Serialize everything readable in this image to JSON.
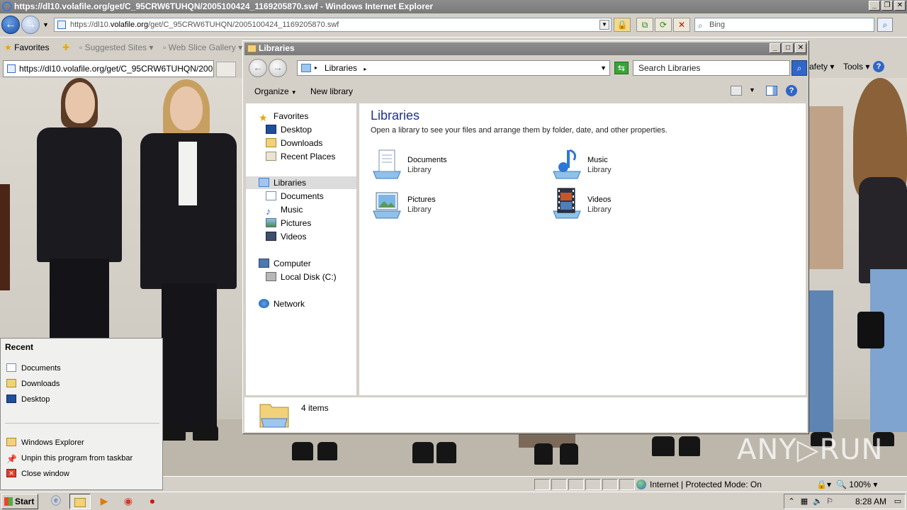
{
  "ie": {
    "title": "https://dl10.volafile.org/get/C_95CRW6TUHQN/2005100424_1169205870.swf - Windows Internet Explorer",
    "url_scheme": "https://dl10.",
    "url_domain": "volafile.org",
    "url_path": "/get/C_95CRW6TUHQN/2005100424_1169205870.swf",
    "search_placeholder": "Bing",
    "favorites_label": "Favorites",
    "suggested_sites": "Suggested Sites",
    "web_slice_gallery": "Web Slice Gallery",
    "tab_title": "https://dl10.volafile.org/get/C_95CRW6TUHQN/2005...",
    "safety_menu": "afety",
    "tools_menu": "Tools",
    "status_zone": "Internet | Protected Mode: On",
    "zoom": "100%"
  },
  "explorer": {
    "title": "Libraries",
    "breadcrumb": "Libraries",
    "search_placeholder": "Search Libraries",
    "toolbar": {
      "organize": "Organize",
      "new_library": "New library"
    },
    "nav": {
      "favorites": "Favorites",
      "desktop": "Desktop",
      "downloads": "Downloads",
      "recent_places": "Recent Places",
      "libraries": "Libraries",
      "documents": "Documents",
      "music": "Music",
      "pictures": "Pictures",
      "videos": "Videos",
      "computer": "Computer",
      "local_disk": "Local Disk (C:)",
      "network": "Network"
    },
    "heading": "Libraries",
    "subheading": "Open a library to see your files and arrange them by folder, date, and other properties.",
    "libraries": [
      {
        "name": "Documents",
        "type": "Library",
        "icon": "documents-library-icon"
      },
      {
        "name": "Music",
        "type": "Library",
        "icon": "music-library-icon"
      },
      {
        "name": "Pictures",
        "type": "Library",
        "icon": "pictures-library-icon"
      },
      {
        "name": "Videos",
        "type": "Library",
        "icon": "videos-library-icon"
      }
    ],
    "details_count": "4 items"
  },
  "jumplist": {
    "recent_title": "Recent",
    "recent": [
      "Documents",
      "Downloads",
      "Desktop"
    ],
    "tasks": [
      "Windows Explorer",
      "Unpin this program from taskbar",
      "Close window"
    ]
  },
  "taskbar": {
    "start": "Start",
    "clock": "8:28 AM"
  },
  "watermark": "ANY▷RUN",
  "colors": {
    "title_gray": "#7c7c7c",
    "heading_blue": "#1e3287",
    "accent_blue": "#2f66c8"
  }
}
